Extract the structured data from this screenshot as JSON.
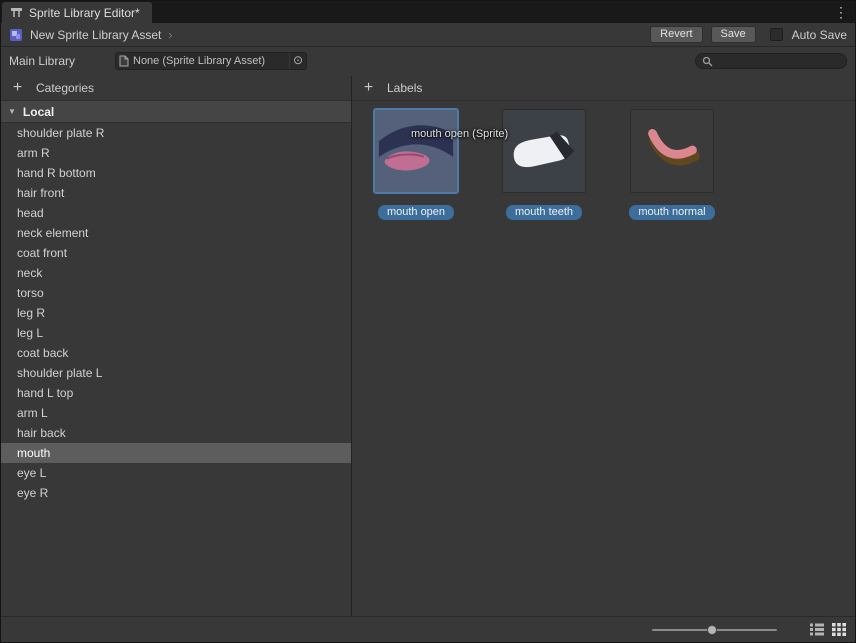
{
  "window": {
    "tab": "Sprite Library Editor*"
  },
  "icons": {
    "kebab": "⋮",
    "plus": "+",
    "foldout": "▼",
    "breadcrumb_sep": "›",
    "picker": "⊙"
  },
  "toolbar": {
    "asset_breadcrumb": "New Sprite Library Asset",
    "revert": "Revert",
    "save": "Save",
    "auto_save": "Auto Save",
    "auto_save_checked": false
  },
  "library_row": {
    "label": "Main Library",
    "object_value": "None (Sprite Library Asset)"
  },
  "search": {
    "value": "",
    "placeholder": ""
  },
  "categories": {
    "header": "Categories",
    "group": "Local",
    "selected": "mouth",
    "items": [
      {
        "label": "shoulder plate R",
        "selected": false
      },
      {
        "label": "arm R",
        "selected": false
      },
      {
        "label": "hand R bottom",
        "selected": false
      },
      {
        "label": "hair front",
        "selected": false
      },
      {
        "label": "head",
        "selected": false
      },
      {
        "label": "neck element",
        "selected": false
      },
      {
        "label": "coat front",
        "selected": false
      },
      {
        "label": "neck",
        "selected": false
      },
      {
        "label": "torso",
        "selected": false
      },
      {
        "label": "leg R",
        "selected": false
      },
      {
        "label": "leg L",
        "selected": false
      },
      {
        "label": "coat back",
        "selected": false
      },
      {
        "label": "shoulder plate L",
        "selected": false
      },
      {
        "label": "hand L top",
        "selected": false
      },
      {
        "label": "arm L",
        "selected": false
      },
      {
        "label": "hair back",
        "selected": false
      },
      {
        "label": "mouth",
        "selected": true
      },
      {
        "label": "eye L",
        "selected": false
      },
      {
        "label": "eye R",
        "selected": false
      }
    ]
  },
  "labels": {
    "header": "Labels",
    "tooltip": "mouth open (Sprite)",
    "items": [
      {
        "name": "mouth open",
        "selected": true
      },
      {
        "name": "mouth teeth",
        "selected": false
      },
      {
        "name": "mouth normal",
        "selected": false
      }
    ]
  },
  "bottom_bar": {
    "zoom_slider_value": 0.48
  },
  "colors": {
    "label_pill": "#3d6e9b",
    "selection_row": "#5d5d5d",
    "accent_border": "#4e7ba9"
  }
}
